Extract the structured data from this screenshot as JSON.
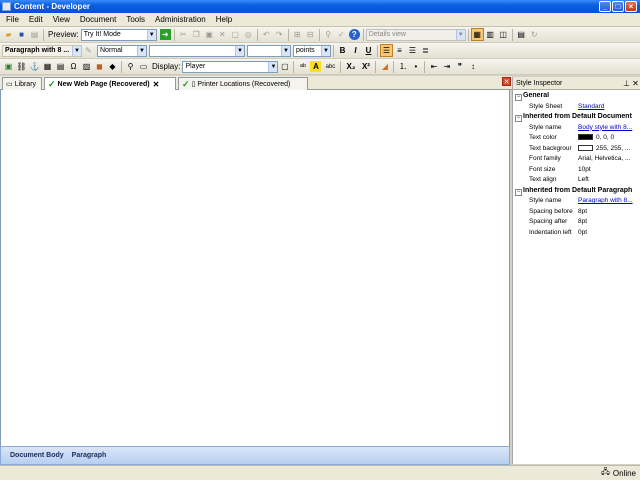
{
  "window": {
    "title": "Content - Developer"
  },
  "menu": [
    "File",
    "Edit",
    "View",
    "Document",
    "Tools",
    "Administration",
    "Help"
  ],
  "toolbar1": {
    "preview_label": "Preview:",
    "preview_mode": "Try It! Mode",
    "view_mode": "Details view"
  },
  "toolbar2": {
    "paragraph_style": "Paragraph with 8 ...",
    "font_style": "Normal",
    "font_family": "",
    "font_size": "",
    "size_unit": "points",
    "bold": "B",
    "italic": "I",
    "underline": "U"
  },
  "toolbar3": {
    "display_label": "Display:",
    "display_value": "Player",
    "highlight_icon": "A",
    "abc_icon": "abc",
    "subscript": "X₂",
    "superscript": "X²"
  },
  "tabs": [
    {
      "label": "Library"
    },
    {
      "label": "New Web Page (Recovered)"
    },
    {
      "label": "Printer Locations (Recovered)"
    }
  ],
  "path": [
    "Document Body",
    "Paragraph"
  ],
  "inspector": {
    "title": "Style Inspector",
    "groups": [
      {
        "title": "General",
        "rows": [
          {
            "key": "Style Sheet",
            "value": "Standard",
            "link": true
          }
        ]
      },
      {
        "title": "Inherited from Default Document",
        "rows": [
          {
            "key": "Style name",
            "value": "Body style with 8...",
            "link": true
          },
          {
            "key": "Text color",
            "value": "0, 0, 0",
            "swatch": "#000000"
          },
          {
            "key": "Text backgrour",
            "value": "255, 255, ...",
            "swatch": "#ffffff"
          },
          {
            "key": "Font family",
            "value": "Arial, Helvetica, ..."
          },
          {
            "key": "Font size",
            "value": "10pt"
          },
          {
            "key": "Text align",
            "value": "Left"
          }
        ]
      },
      {
        "title": "Inherited from Default Paragraph",
        "rows": [
          {
            "key": "Style name",
            "value": "Paragraph with 8...",
            "link": true
          },
          {
            "key": "Spacing before",
            "value": "8pt"
          },
          {
            "key": "Spacing after",
            "value": "8pt"
          },
          {
            "key": "Indentation left",
            "value": "0pt"
          }
        ]
      }
    ]
  },
  "status": {
    "connection": "Online"
  },
  "colors": {
    "titlebar": "#0a5fe0",
    "pathbar": "#b7cff0",
    "link": "#0000cc"
  }
}
